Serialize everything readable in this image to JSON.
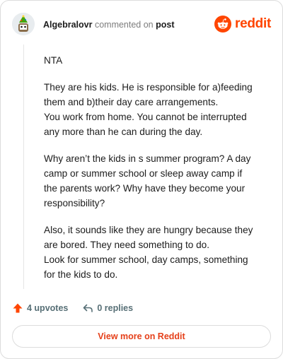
{
  "header": {
    "author": "Algebralovr",
    "commented_on": "commented on",
    "post_link": "post",
    "brand": "reddit"
  },
  "comment": {
    "paragraphs": [
      [
        "NTA"
      ],
      [
        "They are his kids. He is responsible for a)feeding",
        "them and b)their day care arrangements.",
        "You work from home. You cannot be interrupted",
        "any more than he can during the day."
      ],
      [
        "Why aren’t the kids in s summer program? A day",
        "camp or summer school or sleep away camp if",
        "the parents work? Why have they become your",
        "responsibility?"
      ],
      [
        "Also, it sounds like they are hungry because they",
        "are bored. They need something to do.",
        "Look for summer school, day camps, something",
        "for the kids to do."
      ]
    ]
  },
  "actions": {
    "upvotes": "4 upvotes",
    "replies": "0 replies"
  },
  "cta": {
    "label": "View more on Reddit"
  },
  "colors": {
    "brand": "#ff4500",
    "upvote": "#ff4500",
    "muted": "#576f76"
  }
}
